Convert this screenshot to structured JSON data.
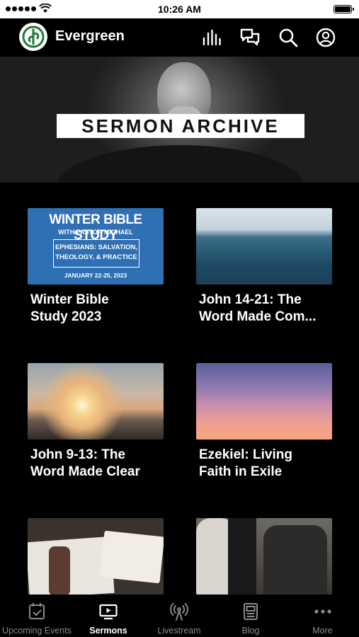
{
  "status_bar": {
    "time": "10:26 AM"
  },
  "header": {
    "app_name": "Evergreen"
  },
  "hero": {
    "title": "SERMON ARCHIVE"
  },
  "series": [
    {
      "title_lines": [
        "Winter Bible",
        "Study 2023"
      ],
      "thumb_text": {
        "line1": "WINTER BIBLE STUDY",
        "line2": "WITH PASTOR MICHAEL",
        "box_line1": "EPHESIANS: SALVATION,",
        "box_line2": "THEOLOGY, & PRACTICE",
        "dates": "JANUARY 22-25, 2023"
      }
    },
    {
      "title_lines": [
        "John 14-21: The",
        "Word Made Com..."
      ]
    },
    {
      "title_lines": [
        "John 9-13: The",
        "Word Made Clear"
      ]
    },
    {
      "title_lines": [
        "Ezekiel: Living",
        "Faith in Exile"
      ]
    },
    {
      "title_lines": [
        "",
        ""
      ]
    },
    {
      "title_lines": [
        "",
        ""
      ]
    }
  ],
  "tabs": [
    {
      "label": "Upcoming Events",
      "icon": "calendar-check-icon",
      "active": false
    },
    {
      "label": "Sermons",
      "icon": "tv-play-icon",
      "active": true
    },
    {
      "label": "Livestream",
      "icon": "broadcast-tower-icon",
      "active": false
    },
    {
      "label": "Blog",
      "icon": "newspaper-icon",
      "active": false
    },
    {
      "label": "More",
      "icon": "more-dots-icon",
      "active": false
    }
  ]
}
